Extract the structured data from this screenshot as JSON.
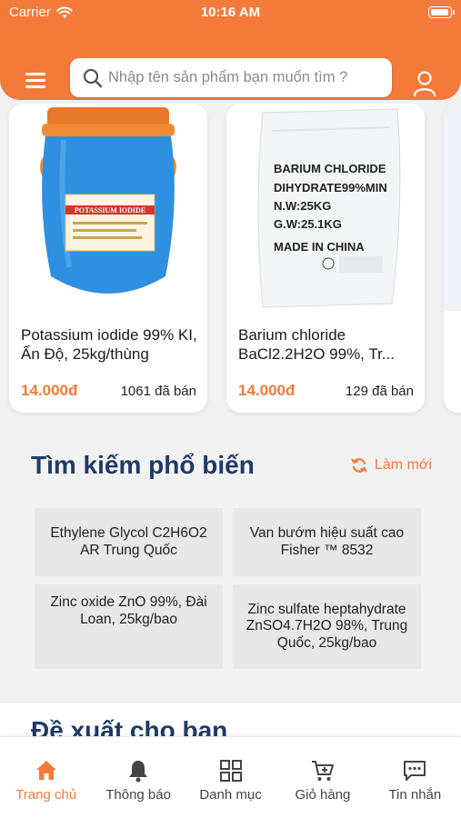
{
  "status_bar": {
    "carrier": "Carrier",
    "time": "10:16 AM"
  },
  "header": {
    "search_placeholder": "Nhập tên sản phẩm bạn muốn tìm ?",
    "accent_color": "#f47a3a"
  },
  "products": [
    {
      "name": "Potassium iodide 99% KI, Ấn Độ, 25kg/thùng",
      "price": "14.000đ",
      "sold": "1061 đã bán",
      "image_label": "POTASSIUM IODIDE"
    },
    {
      "name": "Barium chloride BaCl2.2H2O 99%, Tr...",
      "price": "14.000đ",
      "sold": "129 đã bán",
      "image_lines": [
        "BARIUM CHLORIDE",
        "DIHYDRATE99%MIN",
        "N.W:25KG",
        "G.W:25.1KG",
        "MADE IN CHINA"
      ]
    }
  ],
  "popular": {
    "title": "Tìm kiếm phổ biến",
    "refresh_label": "Làm mới",
    "items": [
      "Ethylene Glycol C2H6O2 AR Trung Quốc",
      "Van bướm hiệu suất cao Fisher ™ 8532",
      "Zinc oxide ZnO 99%, Đài Loan, 25kg/bao",
      "Zinc sulfate heptahydrate ZnSO4.7H2O 98%, Trung Quốc, 25kg/bao"
    ]
  },
  "suggest": {
    "title": "Đề xuất cho bạn"
  },
  "tabs": [
    {
      "label": "Trang chủ",
      "icon": "home-icon",
      "active": true
    },
    {
      "label": "Thông báo",
      "icon": "bell-icon"
    },
    {
      "label": "Danh mục",
      "icon": "grid-icon"
    },
    {
      "label": "Giỏ hàng",
      "icon": "cart-icon"
    },
    {
      "label": "Tin nhắn",
      "icon": "message-icon"
    }
  ]
}
